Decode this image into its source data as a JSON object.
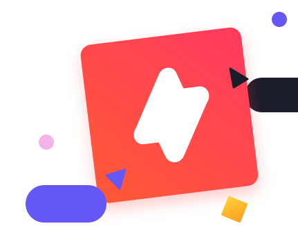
{
  "illustration": {
    "icon": "lightning-bolt-icon",
    "decorations": [
      "purple-dot",
      "pink-dot",
      "dark-pill",
      "purple-pill",
      "dark-triangle",
      "purple-triangle",
      "orange-diamond"
    ]
  },
  "colors": {
    "tile_gradient_start": "#ff3a5e",
    "tile_gradient_end": "#ff5a36",
    "bolt": "#ffffff",
    "purple": "#6457f5",
    "pink": "#f5b4e7",
    "dark": "#1c1d2b",
    "orange_start": "#ffd23c",
    "orange_end": "#ff9d1a"
  }
}
